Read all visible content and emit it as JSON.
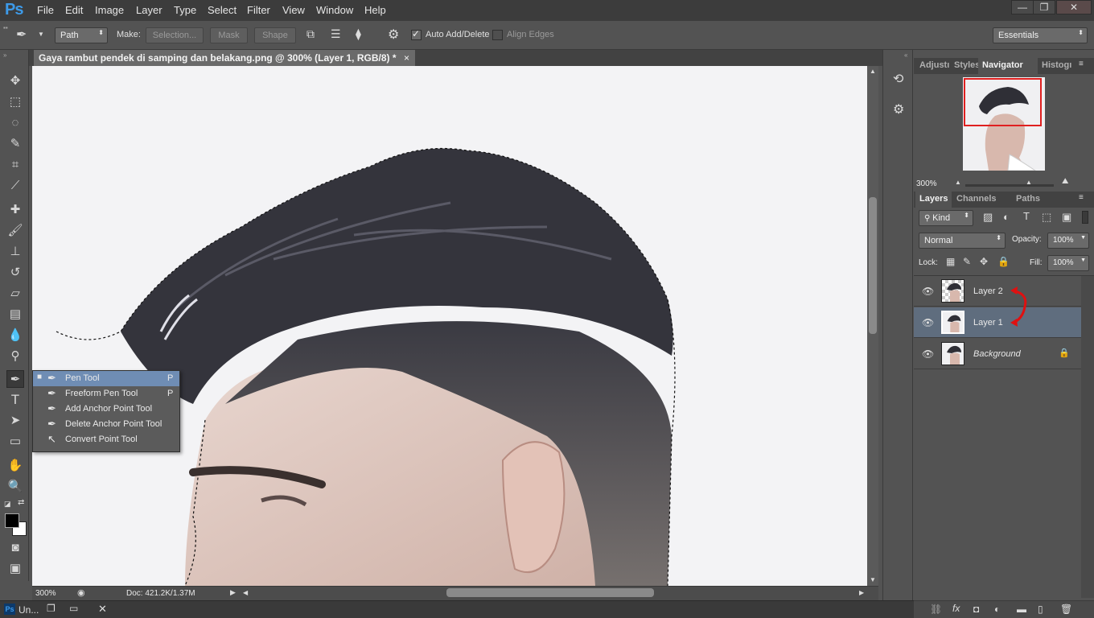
{
  "app": {
    "logo": "Ps"
  },
  "menu": [
    "File",
    "Edit",
    "Image",
    "Layer",
    "Type",
    "Select",
    "Filter",
    "View",
    "Window",
    "Help"
  ],
  "window_controls": {
    "minimize": "—",
    "restore": "❐",
    "close": "✕"
  },
  "options": {
    "mode_value": "Path",
    "make_label": "Make:",
    "selection_label": "Selection...",
    "mask_label": "Mask",
    "shape_label": "Shape",
    "auto_add_delete_label": "Auto Add/Delete",
    "auto_add_delete_checked": true,
    "align_edges_label": "Align Edges",
    "align_edges_checked": false,
    "workspace_value": "Essentials"
  },
  "document": {
    "tab_title": "Gaya rambut pendek di samping dan belakang.png @ 300% (Layer 1, RGB/8) *",
    "tab_close": "×"
  },
  "status": {
    "zoom": "300%",
    "doc_info": "Doc: 421.2K/1.37M"
  },
  "flyout": {
    "items": [
      {
        "label": "Pen Tool",
        "key": "P",
        "selected": true,
        "icon": "pen-icon"
      },
      {
        "label": "Freeform Pen Tool",
        "key": "P",
        "selected": false,
        "icon": "freeform-pen-icon"
      },
      {
        "label": "Add Anchor Point Tool",
        "key": "",
        "selected": false,
        "icon": "add-anchor-icon"
      },
      {
        "label": "Delete Anchor Point Tool",
        "key": "",
        "selected": false,
        "icon": "delete-anchor-icon"
      },
      {
        "label": "Convert Point Tool",
        "key": "",
        "selected": false,
        "icon": "convert-point-icon"
      }
    ]
  },
  "top_panel": {
    "tabs": [
      "Adjustı",
      "Styles",
      "Navigator",
      "Histogı"
    ],
    "active_tab": "Navigator",
    "zoom_value": "300%"
  },
  "layers_panel": {
    "tabs": [
      "Layers",
      "Channels",
      "Paths"
    ],
    "filter_value": "Kind",
    "blend_mode": "Normal",
    "opacity_label": "Opacity:",
    "opacity_value": "100%",
    "lock_label": "Lock:",
    "fill_label": "Fill:",
    "fill_value": "100%",
    "layers": [
      {
        "name": "Layer 2",
        "selected": false,
        "locked": false
      },
      {
        "name": "Layer 1",
        "selected": true,
        "locked": false
      },
      {
        "name": "Background",
        "selected": false,
        "locked": true
      }
    ]
  },
  "taskbar": {
    "app_label": "Un..."
  },
  "colors": {
    "accent_selection": "#6f8db4",
    "annotation_red": "#e01010",
    "navigator_frame": "#e02020"
  }
}
